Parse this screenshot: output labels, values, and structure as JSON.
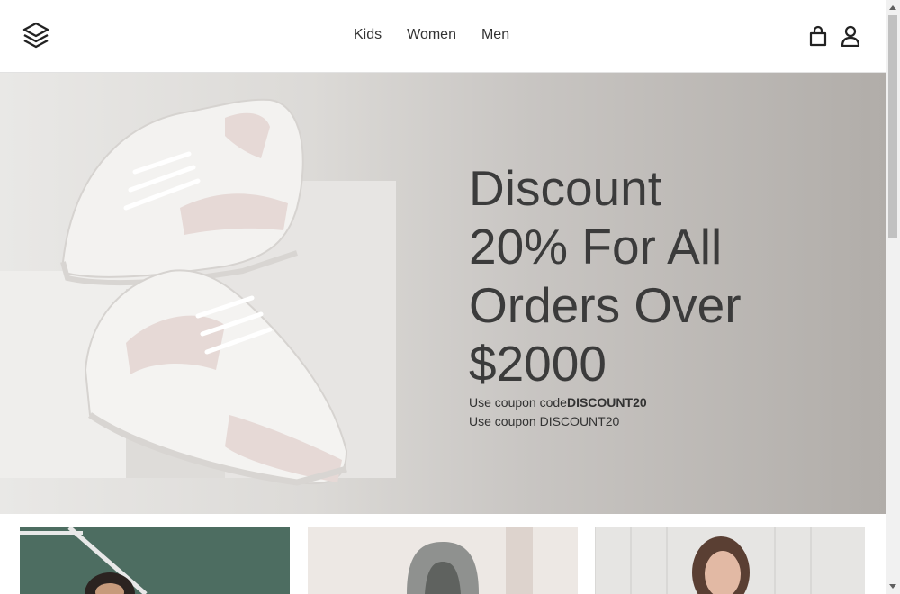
{
  "header": {
    "logo_icon": "layers-logo-icon",
    "nav": [
      {
        "label": "Kids"
      },
      {
        "label": "Women"
      },
      {
        "label": "Men"
      }
    ],
    "icons": [
      "shopping-bag-icon",
      "user-icon"
    ]
  },
  "hero": {
    "title": "Discount\n20% For All\nOrders Over\n$2000",
    "coupon_prefix": "Use coupon code",
    "coupon_code": "DISCOUNT20",
    "coupon_line2": "Use coupon DISCOUNT20"
  },
  "cards": [
    {
      "name": "card-kids"
    },
    {
      "name": "card-women"
    },
    {
      "name": "card-men"
    }
  ],
  "colors": {
    "text": "#333333",
    "hero_bg_light": "#e9e8e6",
    "hero_bg_dark": "#b1ada9"
  }
}
